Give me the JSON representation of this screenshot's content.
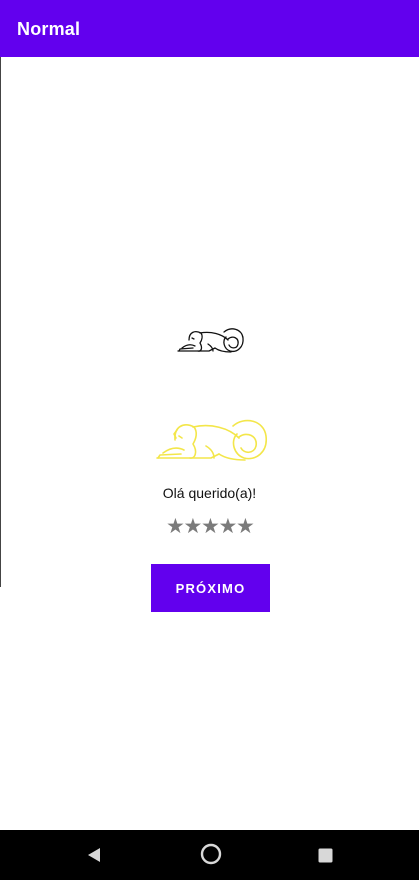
{
  "app_bar": {
    "title": "Normal",
    "color": "#6200ee"
  },
  "main": {
    "greeting": "Olá querido(a)!",
    "rating": {
      "value": 0,
      "max": 5,
      "star_glyph": "★"
    },
    "next_button_label": "PRÓXIMO",
    "images": [
      "lion-outline-black",
      "lion-outline-yellow"
    ]
  },
  "nav_bar": {
    "icons": [
      "back-icon",
      "home-icon",
      "recents-icon"
    ]
  }
}
